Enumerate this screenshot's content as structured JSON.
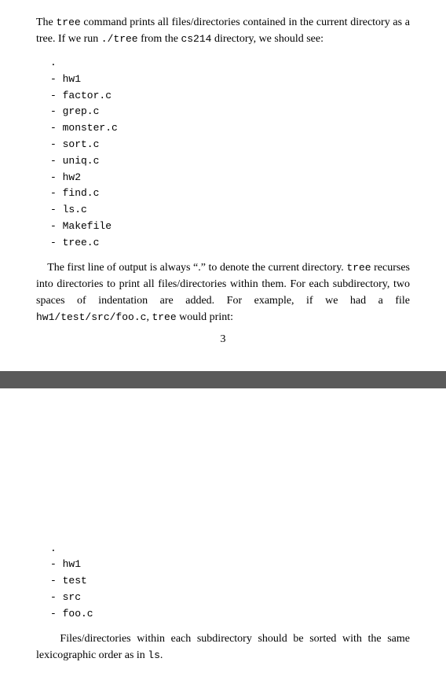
{
  "top": {
    "paragraph1_parts": [
      "The ",
      "tree",
      " command prints all files/directories contained in the current directory as a tree.  If we run ",
      "./tree",
      " from the ",
      "cs214",
      " directory, we should see:"
    ],
    "tree_output": [
      ".",
      "- hw1",
      "  - factor.c",
      "  - grep.c",
      "  - monster.c",
      "  - sort.c",
      "  - uniq.c",
      "- hw2",
      "  - find.c",
      "  - ls.c",
      "  - Makefile",
      "  - tree.c"
    ],
    "paragraph2_parts": [
      "The first line of output is always “.”  to denote the current directory. ",
      "tree",
      " recurses into directories to print all files/directories within them.  For each subdirectory, two spaces of indentation are added.  For example, if we had a file ",
      "hw1/test/src/foo.c",
      ", ",
      "tree",
      " would print:"
    ],
    "page_number": "3"
  },
  "bottom": {
    "tree_output2": [
      ".",
      "- hw1",
      "  - test",
      "    - src",
      "      - foo.c"
    ],
    "paragraph3_parts": [
      "Files/directories within each subdirectory should be sorted with the same lexicographic order as in ",
      "ls",
      "."
    ]
  }
}
